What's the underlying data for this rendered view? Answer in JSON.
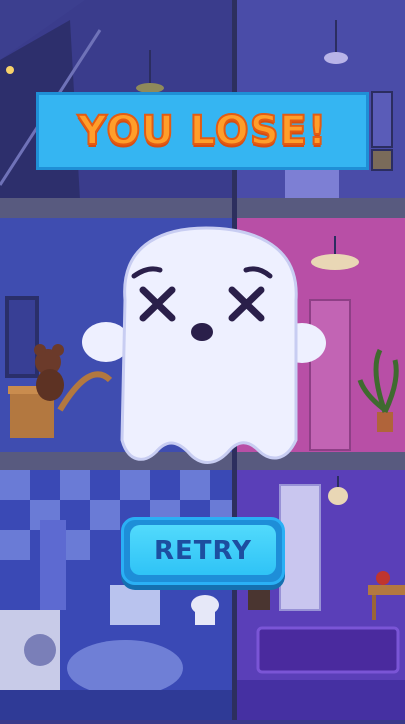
{
  "banner": {
    "text": "YOU LOSE!"
  },
  "retry_button": {
    "label": "RETRY"
  },
  "colors": {
    "banner_bg": "#35b5f2",
    "banner_text": "#ff9e2a",
    "retry_bg": "#2fc3f6",
    "retry_text": "#1d4ea0",
    "ghost_body": "#eef0ff"
  }
}
